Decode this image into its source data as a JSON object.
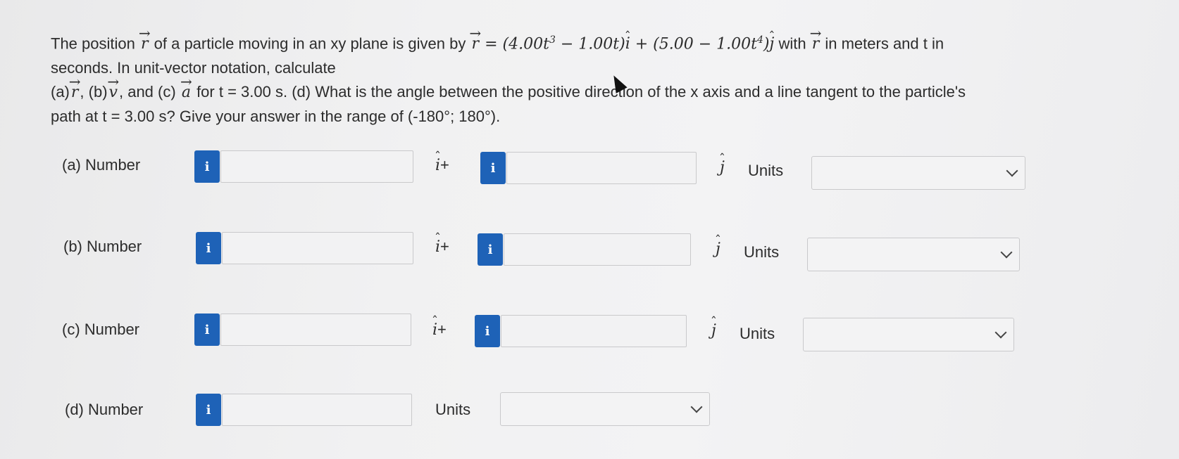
{
  "problem": {
    "line1_a": "The position",
    "line1_b": "of a particle moving in an xy plane is given by",
    "r_symbol": "r",
    "eq_rhs_1": "= (4.00t",
    "eq_exp_3": "3",
    "eq_rhs_2": " − 1.00t)",
    "i_hat": "i",
    "eq_rhs_3": " + (5.00 − 1.00t",
    "eq_exp_4": "4",
    "eq_rhs_4": ")",
    "j_hat": "j",
    "line1_c": "with",
    "line1_d": "in meters and t in",
    "line2": "seconds. In unit-vector notation, calculate",
    "line3_a": "(a)",
    "line3_b": ", (b)",
    "v_symbol": "v",
    "line3_c": ", and (c)",
    "a_symbol": "a",
    "line3_d": "for t = 3.00 s. (d) What is the angle between the positive direction of the x axis and a line tangent to the particle's",
    "line4": "path at t = 3.00 s? Give your answer in the range of (-180°; 180°)."
  },
  "rows": [
    {
      "label": "(a)  Number",
      "i_suffix": "+",
      "units_label": "Units",
      "info": "i",
      "value_i": "",
      "value_j": "",
      "units_value": ""
    },
    {
      "label": "(b)  Number",
      "i_suffix": "+",
      "units_label": "Units",
      "info": "i",
      "value_i": "",
      "value_j": "",
      "units_value": ""
    },
    {
      "label": "(c)  Number",
      "i_suffix": "+",
      "units_label": "Units",
      "info": "i",
      "value_i": "",
      "value_j": "",
      "units_value": ""
    },
    {
      "label": "(d)  Number",
      "units_label": "Units",
      "info": "i",
      "value": "",
      "units_value": ""
    }
  ],
  "unit_vectors": {
    "i": "i",
    "j": "j"
  },
  "colors": {
    "info_button": "#1e62b7",
    "input_bg": "#f2f2f3",
    "border": "#c9c9cb"
  }
}
